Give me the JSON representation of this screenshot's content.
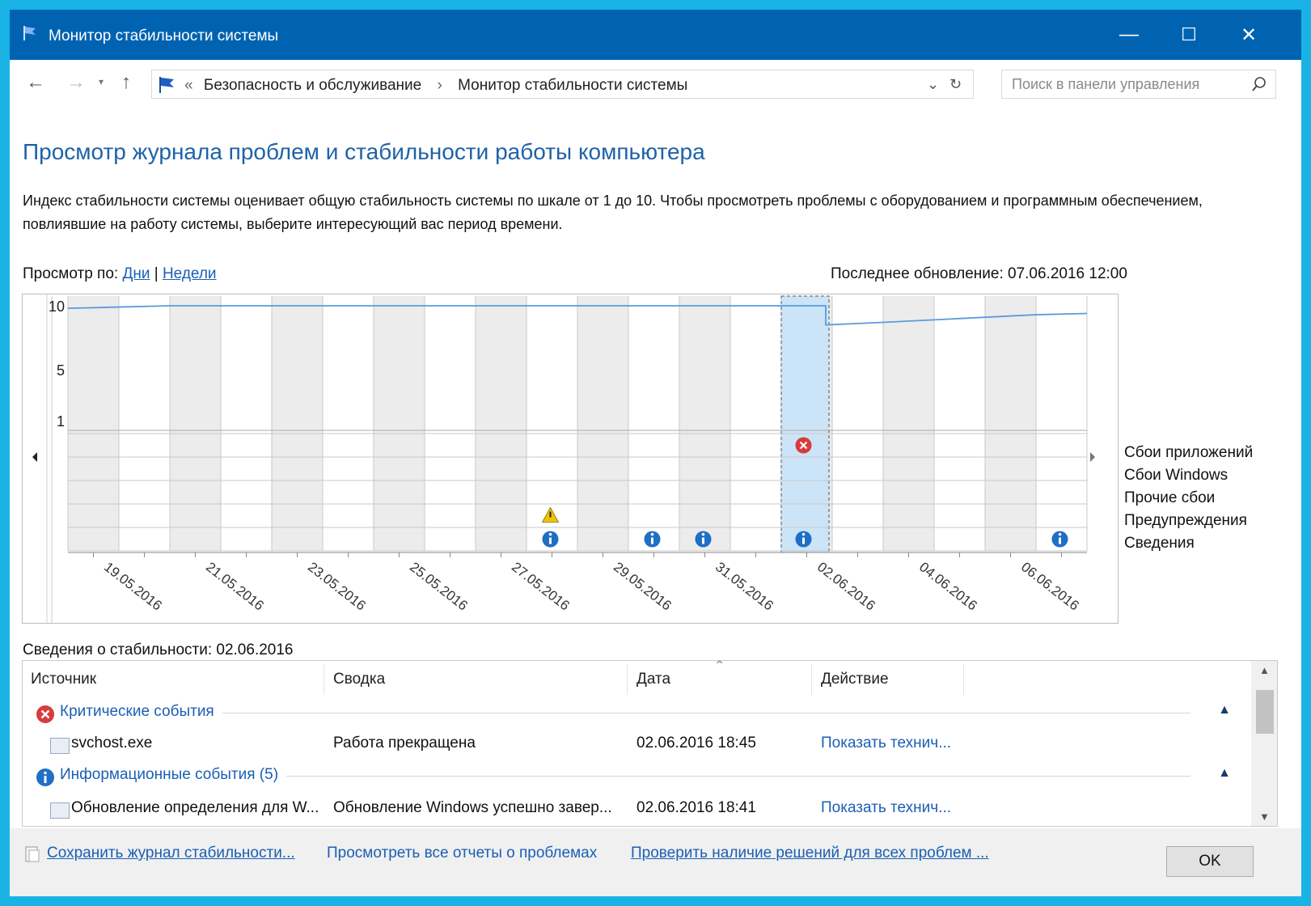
{
  "window": {
    "title": "Монитор стабильности системы",
    "controls": {
      "minimize": "—",
      "maximize": "☐",
      "close": "✕"
    }
  },
  "address_bar": {
    "prefix": "«",
    "breadcrumb": [
      "Безопасность и обслуживание",
      "Монитор стабильности системы"
    ],
    "separator": "›",
    "search_placeholder": "Поиск в панели управления"
  },
  "page": {
    "heading": "Просмотр журнала проблем и стабильности работы компьютера",
    "description": "Индекс стабильности системы оценивает общую стабильность системы по шкале от 1 до 10. Чтобы просмотреть проблемы с оборудованием и программным обеспечением, повлиявшие на работу системы, выберите интересующий вас период времени.",
    "view_by_label": "Просмотр по:",
    "view_days": "Дни",
    "view_divider": "|",
    "view_weeks": "Недели",
    "last_update": "Последнее обновление: 07.06.2016 12:00"
  },
  "chart_data": {
    "type": "line",
    "y_ticks": [
      10,
      5,
      1
    ],
    "ylim": [
      1,
      10
    ],
    "columns": 20,
    "selected_column": 15,
    "date_labels": [
      "19.05.2016",
      "21.05.2016",
      "23.05.2016",
      "25.05.2016",
      "27.05.2016",
      "29.05.2016",
      "31.05.2016",
      "02.06.2016",
      "04.06.2016",
      "06.06.2016"
    ],
    "stability_index": [
      9.8,
      9.9,
      10,
      10,
      10,
      10,
      10,
      10,
      10,
      10,
      10,
      10,
      10,
      10,
      10,
      8.5,
      8.7,
      8.9,
      9.1,
      9.3,
      9.4
    ],
    "event_rows": [
      "Сбои приложений",
      "Сбои Windows",
      "Прочие сбои",
      "Предупреждения",
      "Сведения"
    ],
    "events": [
      {
        "column": 15,
        "row": 0,
        "kind": "error"
      },
      {
        "column": 10,
        "row": 3,
        "kind": "warning"
      },
      {
        "column": 10,
        "row": 4,
        "kind": "info"
      },
      {
        "column": 12,
        "row": 4,
        "kind": "info"
      },
      {
        "column": 13,
        "row": 4,
        "kind": "info"
      },
      {
        "column": 15,
        "row": 4,
        "kind": "info"
      },
      {
        "column": 20,
        "row": 4,
        "kind": "info"
      }
    ],
    "colors": {
      "line": "#5b9bdc",
      "shade": "#ececec",
      "selected": "#cce4f7",
      "error": "#d83b3b",
      "warning": "#f2c200",
      "info": "#1f6fc5"
    }
  },
  "details": {
    "title": "Сведения о стабильности: 02.06.2016",
    "columns": [
      "Источник",
      "Сводка",
      "Дата",
      "Действие"
    ],
    "groups": [
      {
        "label": "Критические события",
        "icon": "error-icon",
        "rows": [
          {
            "source": "svchost.exe",
            "summary": "Работа прекращена",
            "date": "02.06.2016 18:45",
            "action": "Показать технич..."
          }
        ]
      },
      {
        "label": "Информационные события (5)",
        "icon": "info-icon",
        "rows": [
          {
            "source": "Обновление определения для W...",
            "summary": "Обновление Windows успешно завер...",
            "date": "02.06.2016 18:41",
            "action": "Показать технич..."
          }
        ]
      }
    ]
  },
  "footer": {
    "save": "Сохранить журнал стабильности...",
    "view_all": "Просмотреть все отчеты о проблемах",
    "check": "Проверить наличие решений для всех проблем ...",
    "ok": "OK"
  }
}
